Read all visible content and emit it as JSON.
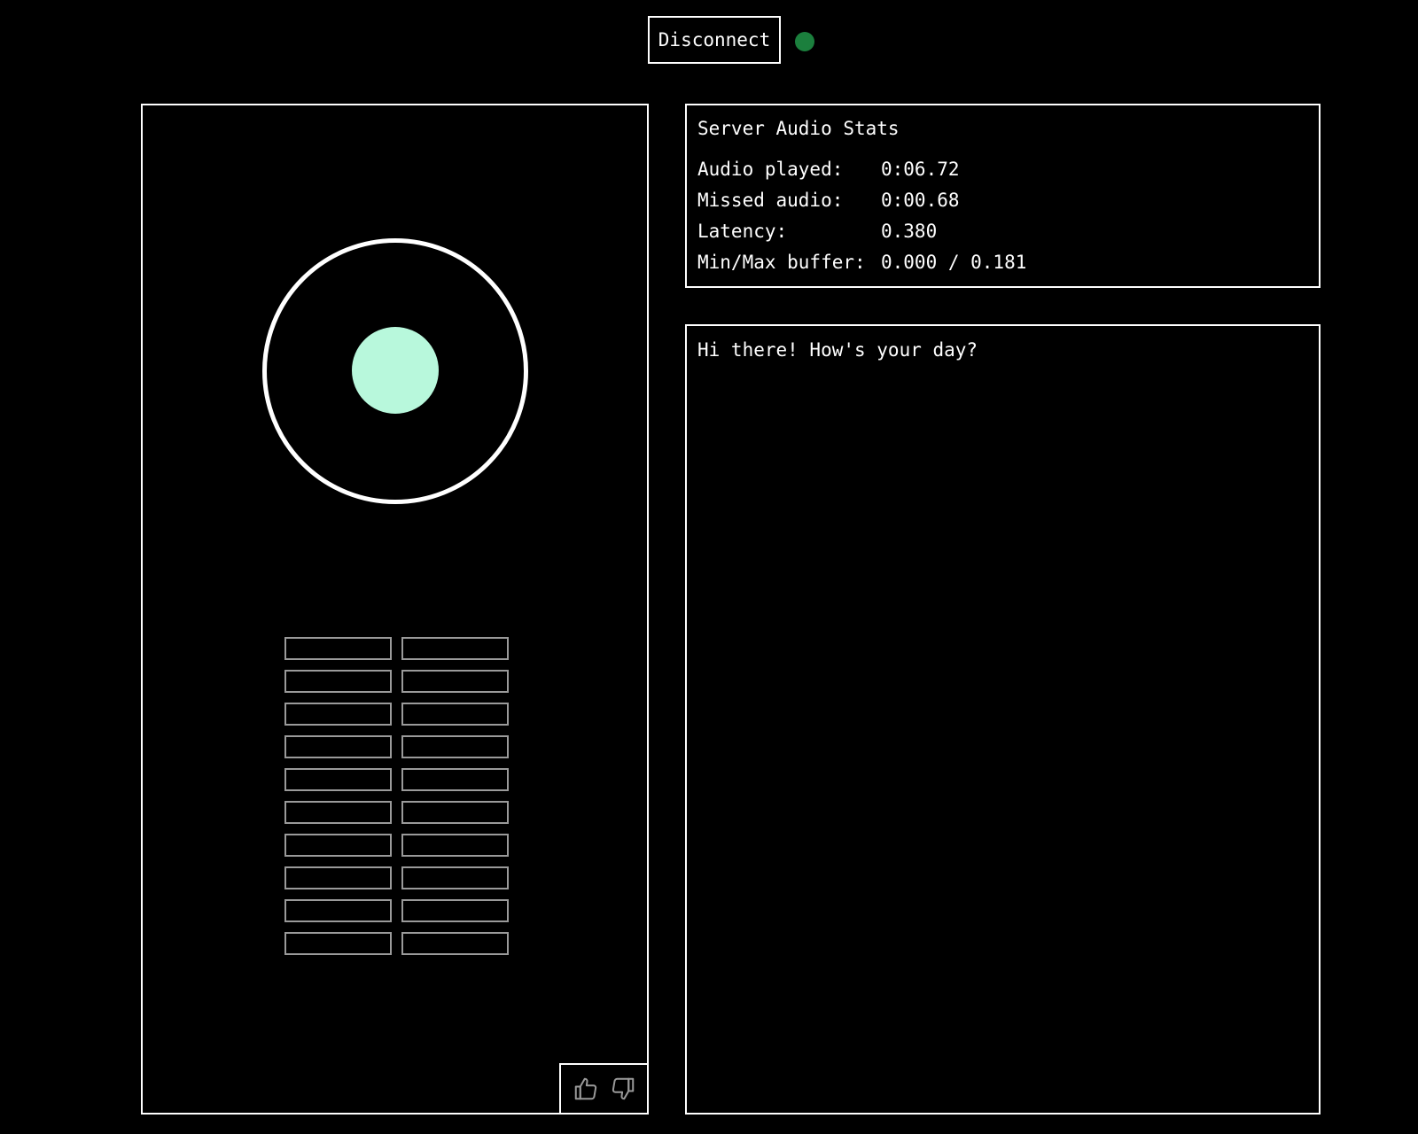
{
  "header": {
    "disconnect_label": "Disconnect",
    "status_color": "#1b7f3d"
  },
  "visualizer": {
    "core_color": "#b8f8dc",
    "ring_color": "#ffffff",
    "meter_rows": 10,
    "meter_cols": 2,
    "meter_border_color": "#9a9a9a"
  },
  "feedback": {
    "thumbs_up_icon": "thumbs-up-icon",
    "thumbs_down_icon": "thumbs-down-icon"
  },
  "stats": {
    "title": "Server Audio Stats",
    "rows": [
      {
        "label": "Audio played:",
        "value": "0:06.72"
      },
      {
        "label": "Missed audio:",
        "value": "0:00.68"
      },
      {
        "label": "Latency:",
        "value": "0.380"
      },
      {
        "label": "Min/Max buffer:",
        "value": "0.000 / 0.181"
      }
    ]
  },
  "transcript": {
    "text": "Hi there! How's your day?"
  }
}
